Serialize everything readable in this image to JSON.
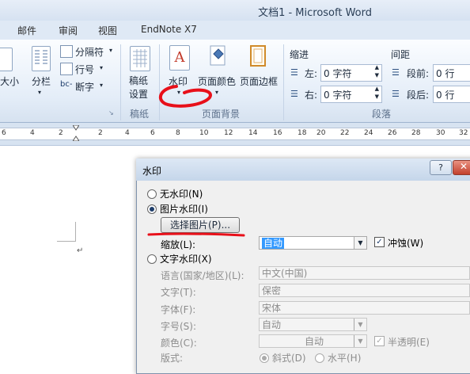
{
  "window": {
    "title": "文档1 - Microsoft Word"
  },
  "tabs": [
    "邮件",
    "审阅",
    "视图",
    "EndNote X7"
  ],
  "ribbon": {
    "page_setup": {
      "size_label": "大小",
      "columns_label": "分栏",
      "breaks_label": "分隔符",
      "line_numbers_label": "行号",
      "hyphenation_label": "断字"
    },
    "draft": {
      "button_label": "稿纸\n设置",
      "group_label": "稿纸"
    },
    "page_background": {
      "watermark_label": "水印",
      "page_color_label": "页面颜色",
      "page_borders_label": "页面边框",
      "group_label": "页面背景"
    },
    "paragraph": {
      "indent_header": "缩进",
      "spacing_header": "间距",
      "left_label": "左:",
      "left_value": "0 字符",
      "right_label": "右:",
      "right_value": "0 字符",
      "before_label": "段前:",
      "before_value": "0 行",
      "after_label": "段后:",
      "after_value": "0 行",
      "group_label": "段落"
    }
  },
  "ruler": {
    "ticks": [
      "6",
      "4",
      "2",
      "2",
      "4",
      "6",
      "8",
      "10",
      "12",
      "14",
      "16",
      "18",
      "20",
      "22",
      "24",
      "26",
      "28",
      "30",
      "32"
    ]
  },
  "dialog": {
    "title": "水印",
    "help_glyph": "?",
    "no_watermark_label": "无水印(N)",
    "picture_watermark_label": "图片水印(I)",
    "select_picture_button": "选择图片(P)...",
    "scale_label": "缩放(L):",
    "scale_value": "自动",
    "washout_label": "冲蚀(W)",
    "washout_checked": true,
    "text_watermark_label": "文字水印(X)",
    "language_label": "语言(国家/地区)(L):",
    "language_value": "中文(中国)",
    "text_label": "文字(T):",
    "text_value": "保密",
    "font_label": "字体(F):",
    "font_value": "宋体",
    "size_label": "字号(S):",
    "size_value": "自动",
    "color_label": "颜色(C):",
    "color_value": "自动",
    "semitransparent_label": "半透明(E)",
    "layout_label": "版式:",
    "diagonal_label": "斜式(D)",
    "horizontal_label": "水平(H)"
  },
  "colors": {
    "annotation_red": "#e8101a",
    "ribbon_bg": "#e4edf8",
    "dialog_bg": "#f0f0f0"
  }
}
